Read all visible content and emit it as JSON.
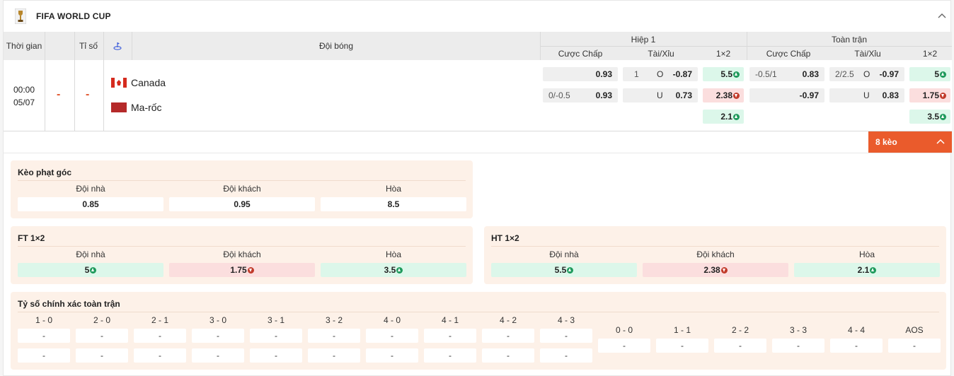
{
  "league": {
    "title": "FIFA WORLD CUP"
  },
  "header": {
    "time": "Thời gian",
    "score": "Tỉ số",
    "team": "Đội bóng",
    "h1": "Hiệp 1",
    "ft": "Toàn trận",
    "cols": [
      "Cược Chấp",
      "Tài/Xỉu",
      "1×2",
      "Cược Chấp",
      "Tài/Xỉu",
      "1×2"
    ]
  },
  "match": {
    "time": "00:00",
    "date": "05/07",
    "score1": "-",
    "score2": "-",
    "home": "Canada",
    "away": "Ma-rốc",
    "h1": {
      "hcp": [
        {
          "line": "",
          "odd": "0.93"
        },
        {
          "line": "0/-0.5",
          "odd": "0.93"
        }
      ],
      "ou": [
        {
          "line": "1",
          "side": "O",
          "odd": "-0.87"
        },
        {
          "line": "",
          "side": "U",
          "odd": "0.73"
        }
      ],
      "x12": [
        {
          "odd": "5.5",
          "dir": "up"
        },
        {
          "odd": "2.38",
          "dir": "down"
        },
        {
          "odd": "2.1",
          "dir": "up"
        }
      ]
    },
    "ft": {
      "hcp": [
        {
          "line": "-0.5/1",
          "odd": "0.83"
        },
        {
          "line": "",
          "odd": "-0.97"
        }
      ],
      "ou": [
        {
          "line": "2/2.5",
          "side": "O",
          "odd": "-0.97"
        },
        {
          "line": "",
          "side": "U",
          "odd": "0.83"
        }
      ],
      "x12": [
        {
          "odd": "5",
          "dir": "up"
        },
        {
          "odd": "1.75",
          "dir": "down"
        },
        {
          "odd": "3.5",
          "dir": "up"
        }
      ]
    }
  },
  "more": {
    "label": "8 kèo"
  },
  "corner": {
    "title": "Kèo phạt góc",
    "labels": [
      "Đội nhà",
      "Đội khách",
      "Hòa"
    ],
    "values": [
      "0.85",
      "0.95",
      "8.5"
    ]
  },
  "ft12": {
    "title": "FT 1×2",
    "labels": [
      "Đội nhà",
      "Đội khách",
      "Hòa"
    ],
    "values": [
      "5",
      "1.75",
      "3.5"
    ]
  },
  "ht12": {
    "title": "HT 1×2",
    "labels": [
      "Đội nhà",
      "Đội khách",
      "Hòa"
    ],
    "values": [
      "5.5",
      "2.38",
      "2.1"
    ]
  },
  "exact": {
    "title": "Tỷ số chính xác toàn trận",
    "left": [
      "1 - 0",
      "2 - 0",
      "2 - 1",
      "3 - 0",
      "3 - 1",
      "3 - 2",
      "4 - 0",
      "4 - 1",
      "4 - 2",
      "4 - 3"
    ],
    "right": [
      "0 - 0",
      "1 - 1",
      "2 - 2",
      "3 - 3",
      "4 - 4",
      "AOS"
    ],
    "empty": "-"
  },
  "colors": {
    "accent": "#ea5b2c",
    "up": "#1f9a5c",
    "down": "#c13a2a",
    "green_bg": "#dcf7ea",
    "red_bg": "#fbdede",
    "panel_bg": "#fdf1e8"
  }
}
